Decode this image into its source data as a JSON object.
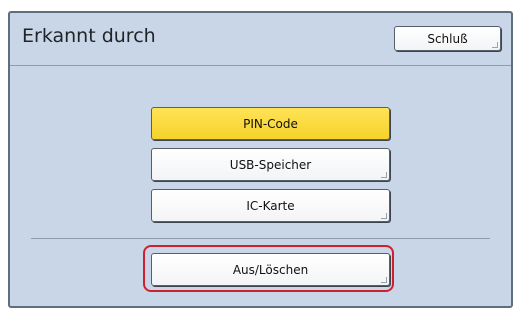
{
  "header": {
    "title": "Erkannt durch",
    "close_label": "Schluß"
  },
  "options": [
    {
      "label": "PIN-Code",
      "selected": true
    },
    {
      "label": "USB-Speicher",
      "selected": false
    },
    {
      "label": "IC-Karte",
      "selected": false
    }
  ],
  "off_delete_label": "Aus/Löschen",
  "colors": {
    "panel_bg": "#c9d6e8",
    "selected_bg": "#f5d22b",
    "highlight_border": "#d0202e"
  }
}
